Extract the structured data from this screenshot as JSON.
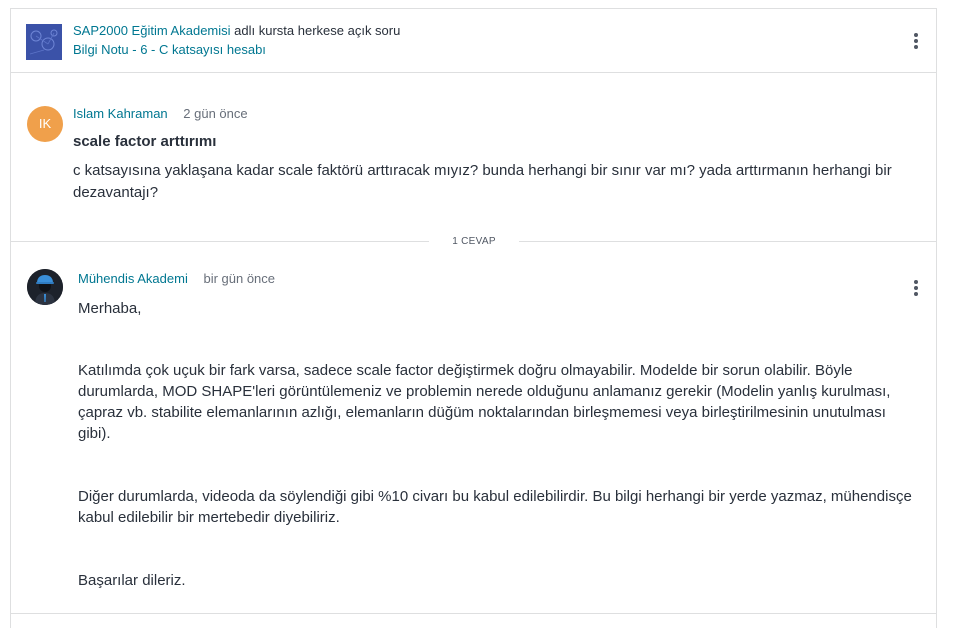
{
  "header": {
    "course_link": "SAP2000 Eğitim Akademisi",
    "course_suffix": "adlı kursta herkese açık soru",
    "lecture_link": "Bilgi Notu - 6 - C katsayısı hesabı"
  },
  "question": {
    "avatar_initials": "IK",
    "author": "Islam Kahraman",
    "time": "2 gün önce",
    "title": "scale factor arttırımı",
    "body": "c katsayısına yaklaşana kadar scale faktörü arttıracak mıyız? bunda herhangi bir sınır var mı? yada arttırmanın herhangi bir dezavantajı?"
  },
  "divider": {
    "label": "1 CEVAP"
  },
  "answer": {
    "author": "Mühendis Akademi",
    "time": "bir gün önce",
    "greeting": "Merhaba,",
    "paragraph1": "Katılımda çok uçuk bir fark varsa, sadece scale factor değiştirmek doğru olmayabilir. Modelde bir sorun olabilir. Böyle durumlarda, MOD SHAPE'leri görüntülemeniz ve problemin nerede olduğunu anlamanız gerekir (Modelin yanlış kurulması, çapraz vb. stabilite elemanlarının azlığı, elemanların düğüm noktalarından birleşmemesi veya birleştirilmesinin unutulması gibi).",
    "paragraph2": "Diğer durumlarda, videoda da söylendiği gibi %10 civarı bu kabul edilebilirdir. Bu bilgi herhangi bir yerde yazmaz, mühendisçe kabul edilebilir bir mertebedir diyebiliriz.",
    "closing": "Başarılar dileriz."
  },
  "colors": {
    "link": "#007791",
    "avatar_ik": "#f0a04b",
    "course_thumb": "#3b52a8"
  },
  "icons": {
    "header_menu": "more-vertical-icon",
    "answer_menu": "more-vertical-icon"
  }
}
